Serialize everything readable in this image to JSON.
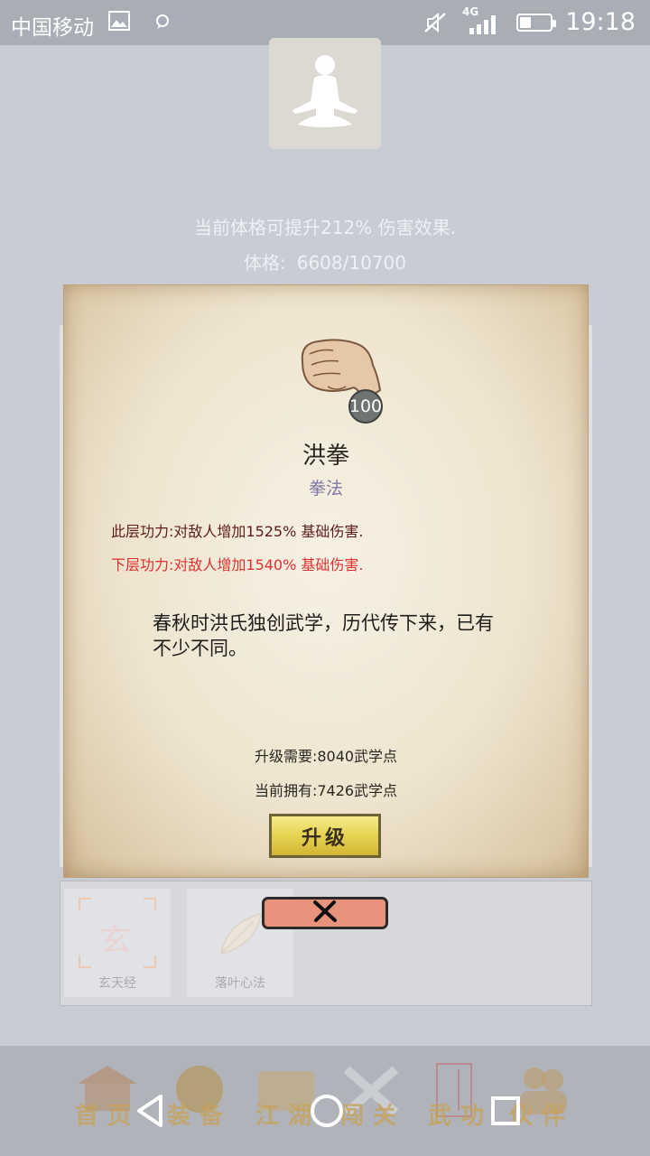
{
  "status_bar": {
    "carrier": "中国移动",
    "network": "4G",
    "time": "19:18"
  },
  "header": {
    "avatar_icon": "meditation-figure-icon",
    "boost_text": "当前体格可提升212% 伤害效果.",
    "stat_label": "体格:",
    "stat_value": "6608/10700"
  },
  "skill_dialog": {
    "icon": "fist-icon",
    "level": "100",
    "name": "洪拳",
    "type": "拳法",
    "current_effect": "此层功力:对敌人增加1525% 基础伤害.",
    "next_effect": "下层功力:对敌人增加1540% 基础伤害.",
    "description": "春秋时洪氏独创武学，历代传下来，已有不少不同。",
    "upgrade_cost": "升级需要:8040武学点",
    "owned_points": "当前拥有:7426武学点",
    "upgrade_label": "升级",
    "close_icon": "close-x-icon"
  },
  "skill_list": {
    "items": [
      {
        "label": "玄天经",
        "glyph": "玄"
      },
      {
        "label": "落叶心法"
      }
    ]
  },
  "bottom_nav": {
    "items": [
      {
        "label": "首页"
      },
      {
        "label": "装备"
      },
      {
        "label": "江湖"
      },
      {
        "label": "闯关"
      },
      {
        "label": "武功"
      },
      {
        "label": "伙伴"
      }
    ]
  },
  "colors": {
    "accent_gold": "#c8a258",
    "next_effect_red": "#e03030",
    "close_button": "#e8937c"
  }
}
